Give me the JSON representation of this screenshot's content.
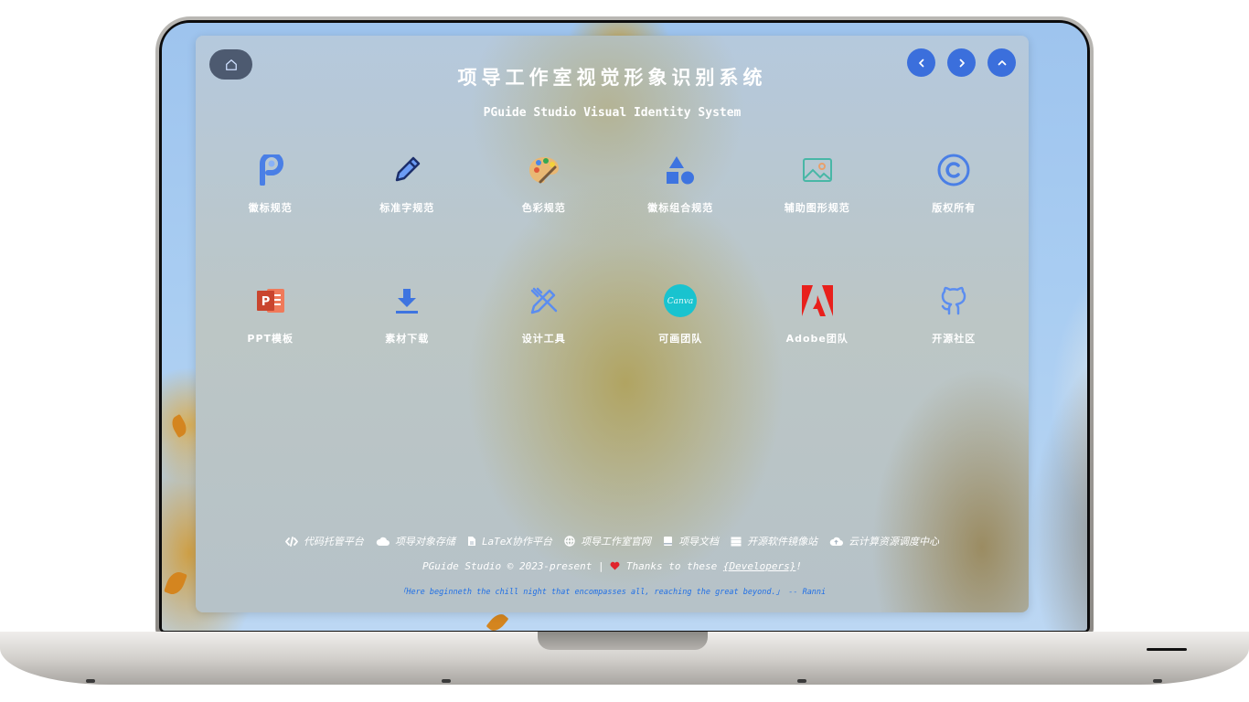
{
  "header": {
    "title": "项导工作室视觉形象识别系统",
    "subtitle": "PGuide Studio Visual Identity System",
    "home_icon": "home-icon",
    "nav": [
      {
        "icon": "chevron-left-icon"
      },
      {
        "icon": "chevron-right-icon"
      },
      {
        "icon": "chevron-up-icon"
      }
    ]
  },
  "tiles": [
    {
      "label": "徽标规范",
      "icon": "pguide-logo-icon",
      "color": "#5b8df0"
    },
    {
      "label": "标准字规范",
      "icon": "pencil-icon",
      "color": "#1c2f6b"
    },
    {
      "label": "色彩规范",
      "icon": "palette-icon",
      "color": "#e6b36a"
    },
    {
      "label": "徽标组合规范",
      "icon": "shapes-icon",
      "color": "#3e74e0"
    },
    {
      "label": "辅助图形规范",
      "icon": "image-icon",
      "color": "#48b7a6"
    },
    {
      "label": "版权所有",
      "icon": "copyright-icon",
      "color": "#4a7fe6"
    },
    {
      "label": "PPT模板",
      "icon": "powerpoint-icon",
      "color": "#c9452e"
    },
    {
      "label": "素材下载",
      "icon": "download-icon",
      "color": "#3e74e0"
    },
    {
      "label": "设计工具",
      "icon": "design-tools-icon",
      "color": "#5b8df0"
    },
    {
      "label": "可画团队",
      "icon": "canva-icon",
      "color": "#19c3cf"
    },
    {
      "label": "Adobe团队",
      "icon": "adobe-icon",
      "color": "#e8201c"
    },
    {
      "label": "开源社区",
      "icon": "github-icon",
      "color": "#5b8df0"
    }
  ],
  "footer": {
    "links": [
      {
        "label": "代码托管平台",
        "icon": "code-icon"
      },
      {
        "label": "项导对象存储",
        "icon": "cloud-icon"
      },
      {
        "label": "LaTeX协作平台",
        "icon": "file-icon"
      },
      {
        "label": "项导工作室官网",
        "icon": "globe-icon"
      },
      {
        "label": "项导文档",
        "icon": "book-icon"
      },
      {
        "label": "开源软件镜像站",
        "icon": "server-icon"
      },
      {
        "label": "云计算资源调度中心",
        "icon": "cloud-upload-icon"
      }
    ],
    "copyright_text": "PGuide Studio © 2023-present | ",
    "thanks_text": " Thanks to these ",
    "developers_link": "{Developers}",
    "exclaim": "!",
    "quote": "「Here beginneth the chill night that encompasses all, reaching the great beyond.」 -- Ranni",
    "heart_color": "#e0242b"
  }
}
